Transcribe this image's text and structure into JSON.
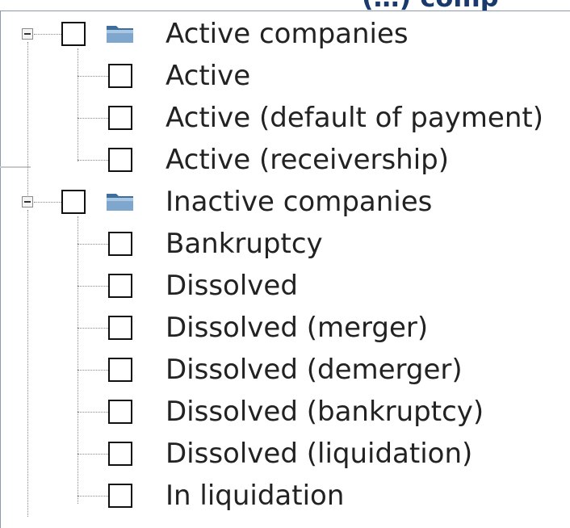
{
  "header": {
    "title_fragment": "(…) comp"
  },
  "tree": {
    "groups": [
      {
        "label": "Active companies",
        "icon": "folder-icon",
        "expanded": true,
        "children": [
          {
            "label": "Active"
          },
          {
            "label": "Active (default of payment)"
          },
          {
            "label": "Active (receivership)"
          }
        ]
      },
      {
        "label": "Inactive companies",
        "icon": "folder-icon",
        "expanded": true,
        "children": [
          {
            "label": "Bankruptcy"
          },
          {
            "label": "Dissolved"
          },
          {
            "label": "Dissolved (merger)"
          },
          {
            "label": "Dissolved (demerger)"
          },
          {
            "label": "Dissolved (bankruptcy)"
          },
          {
            "label": "Dissolved (liquidation)"
          },
          {
            "label": "In liquidation"
          }
        ]
      }
    ]
  },
  "colors": {
    "border": "#8a9bb0",
    "folder": "#4f7aa6",
    "text": "#222222"
  }
}
